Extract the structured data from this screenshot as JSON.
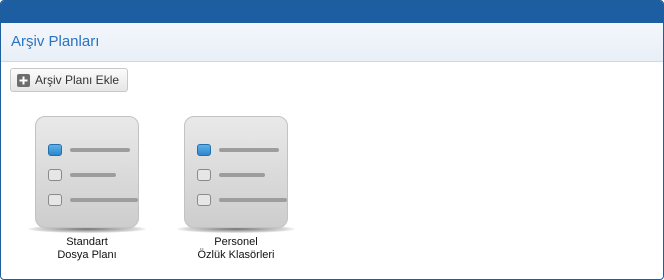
{
  "header": {
    "title": "Arşiv Planları"
  },
  "toolbar": {
    "add_label": "Arşiv Planı Ekle",
    "add_icon": "plus-square-icon"
  },
  "plans": [
    {
      "line1": "Standart",
      "line2": "Dosya Planı",
      "icon": "checklist-icon"
    },
    {
      "line1": "Personel",
      "line2": "Özlük Klasörleri",
      "icon": "checklist-icon"
    }
  ],
  "colors": {
    "topbar": "#1d5ea3",
    "title": "#2a73c2",
    "checked": "#2c86cc"
  }
}
